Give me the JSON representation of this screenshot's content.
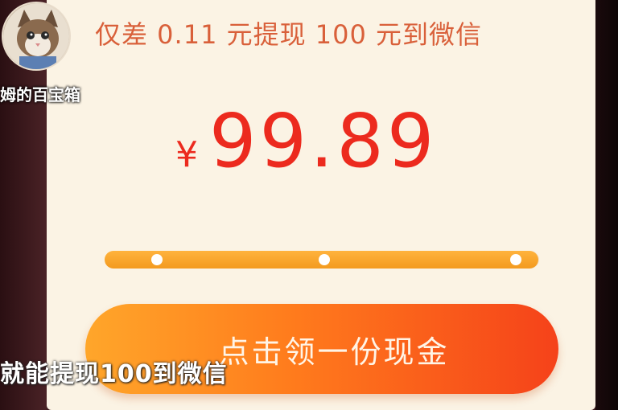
{
  "headline": "仅差 0.11 元提现 100 元到微信",
  "currency_symbol": "¥",
  "amount": "99.89",
  "progress": {
    "fraction": 0.9989,
    "milestones": 3
  },
  "cta_label": "点击领一份现金",
  "channel_name": "姆的百宝箱",
  "subtitle": "就能提现100到微信",
  "avatar_icon": "cat-avatar-icon",
  "colors": {
    "headline": "#d9603a",
    "amount": "#ec2a1e",
    "progress": "#f39a1f",
    "cta_start": "#ffa62a",
    "cta_end": "#f5421a",
    "panel": "#fbf3e4"
  }
}
